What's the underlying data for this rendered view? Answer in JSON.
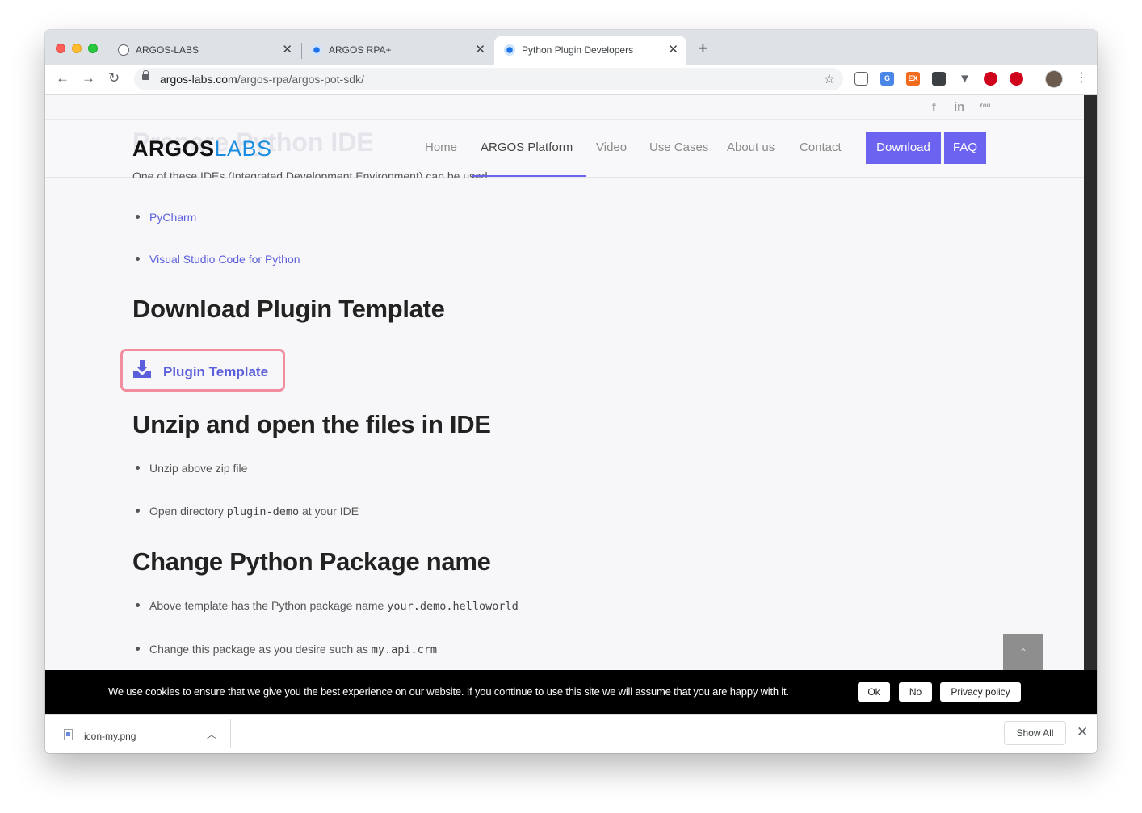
{
  "browser": {
    "tabs": [
      {
        "title": "ARGOS-LABS",
        "active": false
      },
      {
        "title": "ARGOS RPA+",
        "active": false
      },
      {
        "title": "Python Plugin Developers - ARGOS",
        "active": true
      }
    ],
    "new_tab_symbol": "+",
    "close_symbol": "✕",
    "url_domain": "argos-labs.com",
    "url_path": "/argos-rpa/argos-pot-sdk/",
    "extensions": [
      {
        "name": "pocket-icon",
        "color": "#5f6368"
      },
      {
        "name": "translate-icon",
        "color": "#4a86e8"
      },
      {
        "name": "ex-icon",
        "color": "#f26b1d"
      },
      {
        "name": "notes-icon",
        "color": "#3c4043"
      },
      {
        "name": "vee-icon",
        "color": "#5f6368"
      },
      {
        "name": "red-ext-icon",
        "color": "#d0021b"
      },
      {
        "name": "vpn-icon",
        "color": "#d0021b"
      }
    ]
  },
  "site": {
    "social": {
      "facebook": "f",
      "linkedin": "in",
      "youtube": "You"
    },
    "ghost_heading": "Prepare Python IDE",
    "logo": {
      "part1": "ARGOS",
      "part2": "LABS"
    },
    "nav": [
      "Home",
      "ARGOS Platform",
      "Video",
      "Use Cases",
      "About us",
      "Contact"
    ],
    "active_nav": "ARGOS Platform",
    "buttons": {
      "download": "Download",
      "faq": "FAQ"
    },
    "accent": "#6c64f0"
  },
  "content": {
    "cut_text": "One of these IDEs (Integrated Development Environment) can be used",
    "ide_links": [
      "PyCharm",
      "Visual Studio Code for Python"
    ],
    "h_download": "Download Plugin Template",
    "template_button": "Plugin Template",
    "h_unzip": "Unzip and open the files in IDE",
    "unzip_items": {
      "item1": "Unzip above zip file",
      "item2_pre": "Open directory ",
      "item2_code": "plugin-demo",
      "item2_post": " at your IDE"
    },
    "h_change": "Change Python Package name",
    "change_items": {
      "item1_pre": "Above template has the Python package name ",
      "item1_code": "your.demo.helloworld",
      "item2_pre": "Change this package as you desire such as ",
      "item2_code": "my.api.crm"
    },
    "to_top": "⌃"
  },
  "cookie": {
    "text": "We use cookies to ensure that we give you the best experience on our website. If you continue to use this site we will assume that you are happy with it.",
    "ok": "Ok",
    "no": "No",
    "privacy": "Privacy policy"
  },
  "downloads": {
    "file": "icon-my.png",
    "show_all": "Show All"
  }
}
